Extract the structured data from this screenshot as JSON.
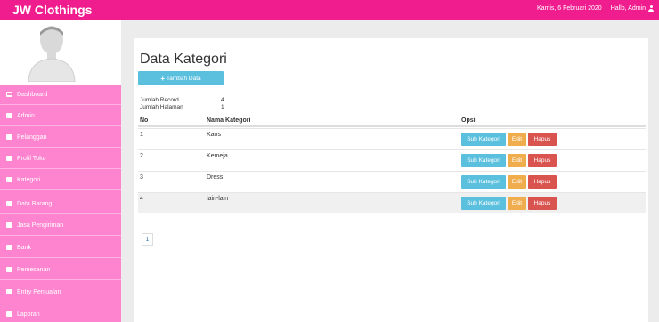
{
  "header": {
    "brand": "JW Clothings",
    "date": "Kamis, 6 Februari 2020",
    "greeting": "Hallo, Admin"
  },
  "sidebar": {
    "items": [
      {
        "label": "Dashboard",
        "icon": "monitor-icon"
      },
      {
        "label": "Admin",
        "icon": "list-icon"
      },
      {
        "label": "Pelanggan",
        "icon": "list-icon"
      },
      {
        "label": "Profil Toko",
        "icon": "list-icon"
      },
      {
        "label": "Kategori",
        "icon": "list-icon"
      },
      {
        "label": "Data Barang",
        "icon": "list-icon"
      },
      {
        "label": "Jasa Pengiriman",
        "icon": "list-icon"
      },
      {
        "label": "Bank",
        "icon": "list-icon"
      },
      {
        "label": "Pemesanan",
        "icon": "list-icon"
      },
      {
        "label": "Entry Penjualan",
        "icon": "list-icon"
      },
      {
        "label": "Laporan",
        "icon": "list-icon"
      }
    ]
  },
  "main": {
    "title": "Data Kategori",
    "add_button": "Tambah Data",
    "info": {
      "record_label": "Jumlah Record",
      "record_value": "4",
      "page_label": "Jumlah Halaman",
      "page_value": "1"
    },
    "table": {
      "headers": [
        "No",
        "Nama Kategori",
        "Opsi"
      ],
      "rows": [
        {
          "no": "1",
          "name": "Kaos"
        },
        {
          "no": "2",
          "name": "Kemeja"
        },
        {
          "no": "3",
          "name": "Dress"
        },
        {
          "no": "4",
          "name": "lain-lain"
        }
      ],
      "actions": {
        "sub": "Sub Kategori",
        "edit": "Edit",
        "delete": "Hapus"
      }
    },
    "pagination": [
      "1"
    ]
  },
  "colors": {
    "topbar": "#f01d8f",
    "sidebar": "#ff84cf",
    "info_button": "#5bc0de",
    "edit_button": "#f0ad4e",
    "delete_button": "#d9534f"
  }
}
